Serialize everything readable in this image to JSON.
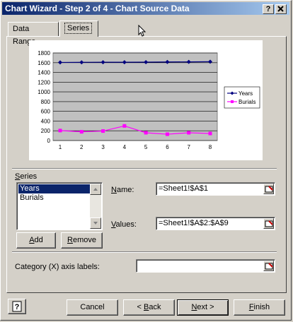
{
  "window": {
    "title": "Chart Wizard - Step 2 of 4 - Chart Source Data",
    "help_btn": "?",
    "close_btn": "X"
  },
  "tabs": [
    {
      "label": "Data Range"
    },
    {
      "label": "Series"
    }
  ],
  "chart_data": {
    "type": "line",
    "x": [
      1,
      2,
      3,
      4,
      5,
      6,
      7,
      8
    ],
    "ylim": [
      0,
      1800
    ],
    "y_ticks": [
      "1800",
      "1600",
      "1400",
      "1200",
      "1000",
      "800",
      "600",
      "400",
      "200",
      "0"
    ],
    "x_ticks": [
      "1",
      "2",
      "3",
      "4",
      "5",
      "6",
      "7",
      "8"
    ],
    "grid": true,
    "legend_placement": "right",
    "series": [
      {
        "name": "Years",
        "color": "#000080",
        "marker": "diamond",
        "values": [
          1605,
          1608,
          1609,
          1610,
          1611,
          1615,
          1617,
          1620
        ]
      },
      {
        "name": "Burials",
        "color": "#ff00ff",
        "marker": "square",
        "values": [
          205,
          180,
          195,
          300,
          160,
          130,
          160,
          145
        ]
      }
    ]
  },
  "series_panel": {
    "label": "Series",
    "items": [
      "Years",
      "Burials"
    ],
    "selected_index": 0,
    "add_label": "Add",
    "remove_label": "Remove"
  },
  "name_field": {
    "label": "Name:",
    "value": "=Sheet1!$A$1"
  },
  "values_field": {
    "label": "Values:",
    "value": "=Sheet1!$A$2:$A$9"
  },
  "category_field": {
    "label": "Category (X) axis labels:",
    "value": ""
  },
  "footer": {
    "cancel": "Cancel",
    "back": "< Back",
    "next": "Next >",
    "finish": "Finish"
  }
}
